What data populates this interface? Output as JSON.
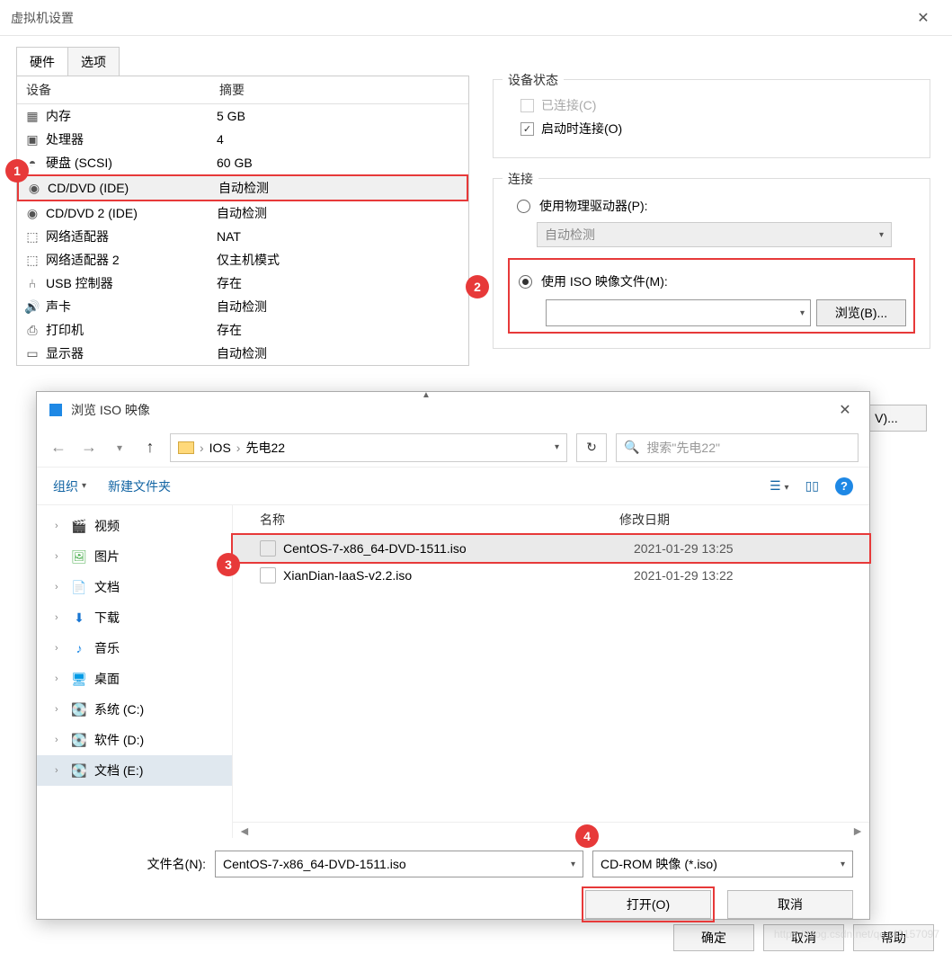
{
  "window": {
    "title": "虚拟机设置"
  },
  "tabs": {
    "hardware": "硬件",
    "options": "选项"
  },
  "deviceTable": {
    "headers": {
      "device": "设备",
      "summary": "摘要"
    },
    "rows": [
      {
        "name": "内存",
        "summary": "5 GB",
        "icon": "memory"
      },
      {
        "name": "处理器",
        "summary": "4",
        "icon": "cpu"
      },
      {
        "name": "硬盘 (SCSI)",
        "summary": "60 GB",
        "icon": "disk"
      },
      {
        "name": "CD/DVD (IDE)",
        "summary": "自动检测",
        "icon": "cd"
      },
      {
        "name": "CD/DVD 2 (IDE)",
        "summary": "自动检测",
        "icon": "cd"
      },
      {
        "name": "网络适配器",
        "summary": "NAT",
        "icon": "net"
      },
      {
        "name": "网络适配器 2",
        "summary": "仅主机模式",
        "icon": "net"
      },
      {
        "name": "USB 控制器",
        "summary": "存在",
        "icon": "usb"
      },
      {
        "name": "声卡",
        "summary": "自动检测",
        "icon": "sound"
      },
      {
        "name": "打印机",
        "summary": "存在",
        "icon": "printer"
      },
      {
        "name": "显示器",
        "summary": "自动检测",
        "icon": "display"
      }
    ]
  },
  "status": {
    "title": "设备状态",
    "connected": "已连接(C)",
    "connectOnStart": "启动时连接(O)"
  },
  "connection": {
    "title": "连接",
    "physical": "使用物理驱动器(P):",
    "physicalDropdown": "自动检测",
    "iso": "使用 ISO 映像文件(M):",
    "browse": "浏览(B)..."
  },
  "advancedBtn": "V)...",
  "mainButtons": {
    "ok": "确定",
    "cancel": "取消",
    "help": "帮助"
  },
  "fileDialog": {
    "title": "浏览 ISO 映像",
    "breadcrumb": {
      "part1": "IOS",
      "part2": "先电22"
    },
    "search": {
      "placeholder": "搜索\"先电22\""
    },
    "toolbar": {
      "organize": "组织",
      "newFolder": "新建文件夹"
    },
    "tree": [
      {
        "label": "视频",
        "icon": "🎬",
        "color": "#3366cc"
      },
      {
        "label": "图片",
        "icon": "🖼",
        "color": "#4caf50"
      },
      {
        "label": "文档",
        "icon": "📄",
        "color": "#888"
      },
      {
        "label": "下载",
        "icon": "⬇",
        "color": "#1976d2"
      },
      {
        "label": "音乐",
        "icon": "♪",
        "color": "#1e88e5"
      },
      {
        "label": "桌面",
        "icon": "🖥",
        "color": "#039be5"
      },
      {
        "label": "系统 (C:)",
        "icon": "💽",
        "color": "#888"
      },
      {
        "label": "软件 (D:)",
        "icon": "💽",
        "color": "#888"
      },
      {
        "label": "文档 (E:)",
        "icon": "💽",
        "color": "#888"
      }
    ],
    "listHeader": {
      "name": "名称",
      "date": "修改日期"
    },
    "files": [
      {
        "name": "CentOS-7-x86_64-DVD-1511.iso",
        "date": "2021-01-29 13:25"
      },
      {
        "name": "XianDian-IaaS-v2.2.iso",
        "date": "2021-01-29 13:22"
      }
    ],
    "footer": {
      "filenameLabel": "文件名(N):",
      "filenameValue": "CentOS-7-x86_64-DVD-1511.iso",
      "filterValue": "CD-ROM 映像 (*.iso)",
      "open": "打开(O)",
      "cancel": "取消"
    }
  },
  "badges": {
    "1": "1",
    "2": "2",
    "3": "3",
    "4": "4"
  },
  "watermark": "https://blog.csdn.net/qq_43157097"
}
